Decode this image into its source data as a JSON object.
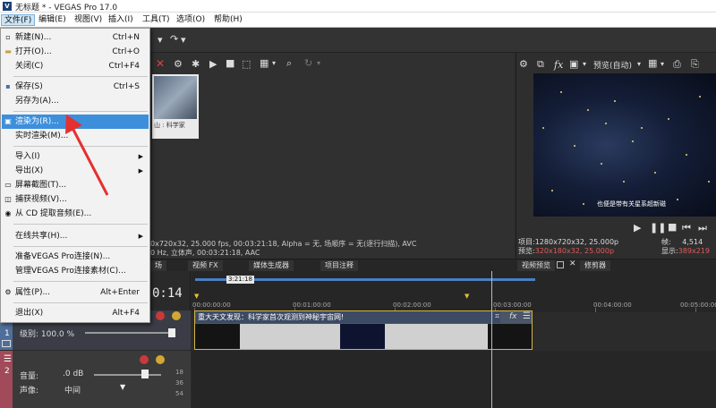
{
  "window": {
    "title": "无标题 * - VEGAS Pro 17.0",
    "app_icon": "V"
  },
  "menubar": {
    "items": [
      "文件(F)",
      "编辑(E)",
      "视图(V)",
      "插入(I)",
      "工具(T)",
      "选项(O)",
      "帮助(H)"
    ]
  },
  "file_menu": {
    "items": [
      {
        "label": "新建(N)...",
        "shortcut": "Ctrl+N"
      },
      {
        "label": "打开(O)...",
        "shortcut": "Ctrl+O"
      },
      {
        "label": "关闭(C)",
        "shortcut": "Ctrl+F4"
      },
      {
        "label": "保存(S)",
        "shortcut": "Ctrl+S"
      },
      {
        "label": "另存为(A)...",
        "shortcut": ""
      },
      {
        "label": "渲染为(R)...",
        "shortcut": ""
      },
      {
        "label": "实时渲染(M)...",
        "shortcut": ""
      },
      {
        "label": "导入(I)",
        "shortcut": ""
      },
      {
        "label": "导出(X)",
        "shortcut": ""
      },
      {
        "label": "屏幕截图(T)...",
        "shortcut": ""
      },
      {
        "label": "捕获视频(V)...",
        "shortcut": ""
      },
      {
        "label": "从 CD 提取音频(E)...",
        "shortcut": ""
      },
      {
        "label": "在线共享(H)...",
        "shortcut": ""
      },
      {
        "label": "准备VEGAS Pro连接(N)...",
        "shortcut": ""
      },
      {
        "label": "管理VEGAS Pro连接素材(C)...",
        "shortcut": ""
      },
      {
        "label": "属性(P)...",
        "shortcut": "Alt+Enter"
      },
      {
        "label": "退出(X)",
        "shortcut": "Alt+F4"
      }
    ]
  },
  "explorer": {
    "thumb_caption": "山 : 科学家",
    "info_line1": "0x720x32, 25.000 fps, 00:03:21:18, Alpha = 无, 场顺序 = 无(逐行扫描), AVC",
    "info_line2": "0 Hz, 立体声, 00:03:21:18, AAC"
  },
  "preview": {
    "quality": "预览(自动)",
    "subtitle": "也便是带有关星系超新磁",
    "project_label": "项目:",
    "project_value": "1280x720x32, 25.000p",
    "preview_label": "预览:",
    "preview_value": "320x180x32, 25.000p",
    "frame_label": "帧:",
    "frame_value": "4,514",
    "display_label": "显示:",
    "display_value": "389x219"
  },
  "tabs": {
    "left1": "场",
    "left2": "视频 FX",
    "left3": "媒体生成器",
    "left4": "项目注释",
    "right1": "视频预览",
    "right2": "修剪器"
  },
  "timeline": {
    "timecode": "0:14",
    "loop_length": "3:21:18",
    "ruler": [
      "00:00:00:00",
      "00:01:00:00",
      "00:02:00:00",
      "00:03:00:00",
      "00:04:00:00",
      "00:05:00:00"
    ],
    "clip_title": "重大天文发现：科学家首次观测到神秘宇宙网!",
    "video_track_num": "1",
    "level_label": "级别: 100.0 %",
    "audio_track_num": "2",
    "volume_label": "音量:",
    "volume_value": ".0 dB",
    "pan_label": "声像:",
    "pan_value": "中间",
    "db_marks": [
      "18",
      "36",
      "54"
    ]
  }
}
